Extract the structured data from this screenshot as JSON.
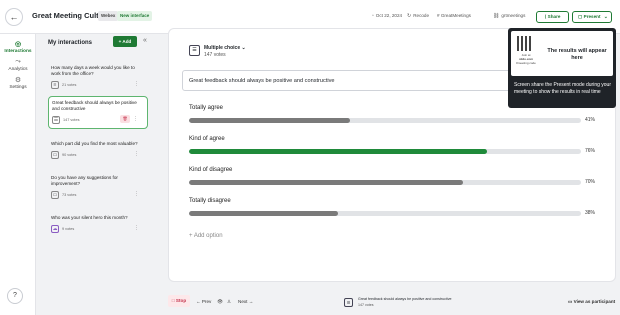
{
  "header": {
    "back_icon": "arrow-left-icon",
    "title": "Great Meeting Culture",
    "badge_beta": "Webex",
    "badge_new": "New interface",
    "date": "Oct 22, 2024",
    "recode": "Recode",
    "hashtag": "# GreatMeetings",
    "link": "grtmeetings",
    "share_label": "Share",
    "present_label": "Present"
  },
  "rail": {
    "interactions": "Interactions",
    "analytics": "Analytics",
    "settings": "Settings",
    "help": "?"
  },
  "panel": {
    "title": "My interactions",
    "add_label": "+ Add",
    "collapse_icon": "double-chevron-left-icon",
    "items": [
      {
        "text": "How many days a week would you like to work from the office?",
        "votes": "21 votes"
      },
      {
        "text": "Great feedback should always be positive and constructive",
        "votes": "147 votes"
      },
      {
        "text": "Which part did you find the most valuable?",
        "votes": "90 votes"
      },
      {
        "text": "Do you have any suggestions for improvement?",
        "votes": "73 votes"
      },
      {
        "text": "Who was your silent hero this month?",
        "votes": "9 votes"
      }
    ]
  },
  "slide": {
    "type": "Multiple choice",
    "votes": "147 votes",
    "question": "Great feedback should always be positive and constructive",
    "options": [
      {
        "label": "Totally agree",
        "pct_text": "41%",
        "pct": 41,
        "color": "#7a7a7a"
      },
      {
        "label": "Kind of agree",
        "pct_text": "76%",
        "pct": 76,
        "color": "#1f8a3a"
      },
      {
        "label": "Kind of disagree",
        "pct_text": "70%",
        "pct": 70,
        "color": "#7a7a7a"
      },
      {
        "label": "Totally disagree",
        "pct_text": "38%",
        "pct": 38,
        "color": "#7a7a7a"
      }
    ],
    "add_option": "+  Add option"
  },
  "tooltip": {
    "join_at": "Join at",
    "site": "slido.com",
    "code_label": "#meeting code",
    "results": "The results will appear here",
    "text": "Screen share the Present mode during your meeting to show the results in real time"
  },
  "bottom": {
    "stop": "Stop",
    "prev": "←  Prev",
    "next": "Next  →",
    "mini_text": "Great feedback should always be positive and constructive",
    "mini_votes": "147 votes",
    "participant": "View as participant"
  }
}
